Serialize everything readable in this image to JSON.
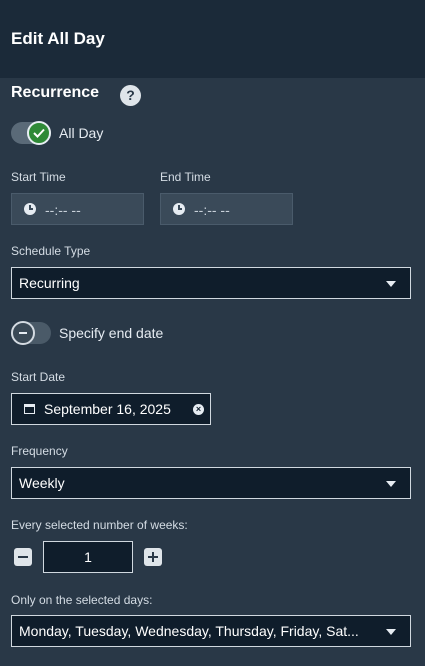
{
  "header": {
    "title": "Edit All Day"
  },
  "recurrence": {
    "title": "Recurrence",
    "help_icon": "?",
    "all_day": {
      "label": "All Day",
      "checked": true
    }
  },
  "time": {
    "start_label": "Start Time",
    "start_value": "--:-- --",
    "end_label": "End Time",
    "end_value": "--:-- --"
  },
  "schedule_type": {
    "label": "Schedule Type",
    "value": "Recurring"
  },
  "end_date_toggle": {
    "label": "Specify end date",
    "checked": false
  },
  "start_date": {
    "label": "Start Date",
    "value": "September 16, 2025",
    "clear_icon": "×"
  },
  "frequency": {
    "label": "Frequency",
    "value": "Weekly"
  },
  "weeks": {
    "label": "Every selected number of weeks:",
    "value": "1"
  },
  "days": {
    "label": "Only on the selected days:",
    "value": "Monday, Tuesday, Wednesday, Thursday, Friday, Sat..."
  },
  "icons": {
    "help": "help-icon",
    "check": "check-icon",
    "minus": "minus-icon",
    "clock": "clock-icon",
    "calendar": "calendar-icon",
    "clear": "clear-icon",
    "caret": "chevron-down-icon",
    "increment": "plus-icon",
    "decrement": "minus-icon"
  },
  "colors": {
    "background": "#293847",
    "header": "#1b2a39",
    "input": "#0f1d2b",
    "toggle_on": "#2f8a37",
    "text": "#e6ecf2"
  }
}
